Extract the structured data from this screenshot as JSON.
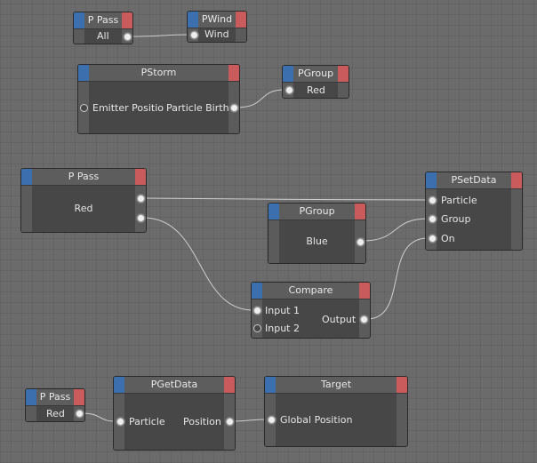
{
  "nodes": {
    "ppass1": {
      "title": "P Pass",
      "out": "All"
    },
    "pwind": {
      "title": "PWind",
      "in": "Wind"
    },
    "pstorm": {
      "title": "PStorm",
      "in": "Emitter Positio",
      "out": "Particle Birth"
    },
    "pgroup1": {
      "title": "PGroup",
      "in": "Red"
    },
    "ppass2": {
      "title": "P Pass",
      "body": "Red"
    },
    "psetdata": {
      "title": "PSetData",
      "in": [
        "Particle",
        "Group",
        "On"
      ]
    },
    "pgroup2": {
      "title": "PGroup",
      "out": "Blue"
    },
    "compare": {
      "title": "Compare",
      "in": [
        "Input 1",
        "Input 2"
      ],
      "out": "Output"
    },
    "ppass3": {
      "title": "P Pass",
      "out": "Red"
    },
    "pgetdata": {
      "title": "PGetData",
      "in": "Particle",
      "out": "Position"
    },
    "target": {
      "title": "Target",
      "in": "Global Position"
    }
  },
  "colors": {
    "input_tab": "#3b6fae",
    "output_tab": "#c95b5c",
    "wire": "#d0d0d0"
  }
}
